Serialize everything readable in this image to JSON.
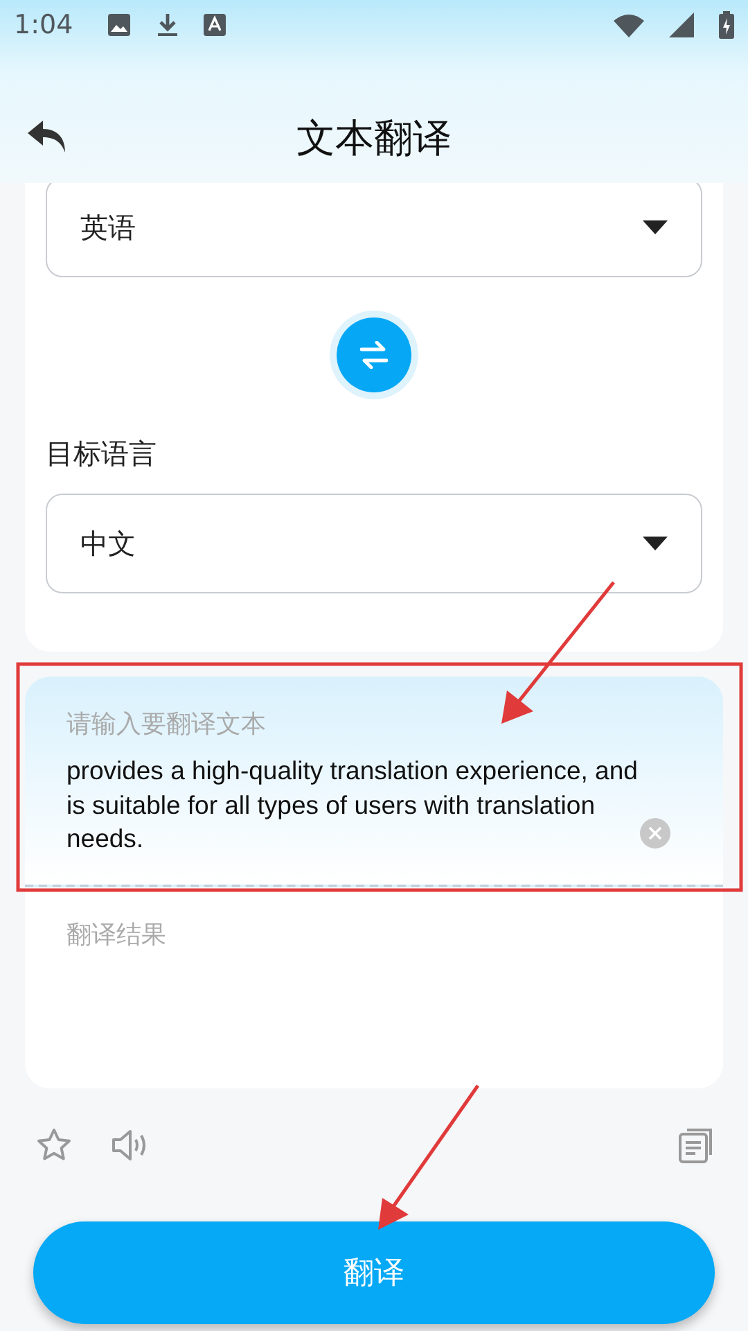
{
  "status_bar": {
    "time": "1:04"
  },
  "header": {
    "title": "文本翻译"
  },
  "source_language": {
    "value": "英语"
  },
  "target_language": {
    "label": "目标语言",
    "value": "中文"
  },
  "input": {
    "placeholder": "请输入要翻译文本",
    "value": "provides a high-quality translation experience, and is suitable for all types of users with translation needs."
  },
  "result": {
    "placeholder": "翻译结果"
  },
  "translate_button": {
    "label": "翻译"
  }
}
